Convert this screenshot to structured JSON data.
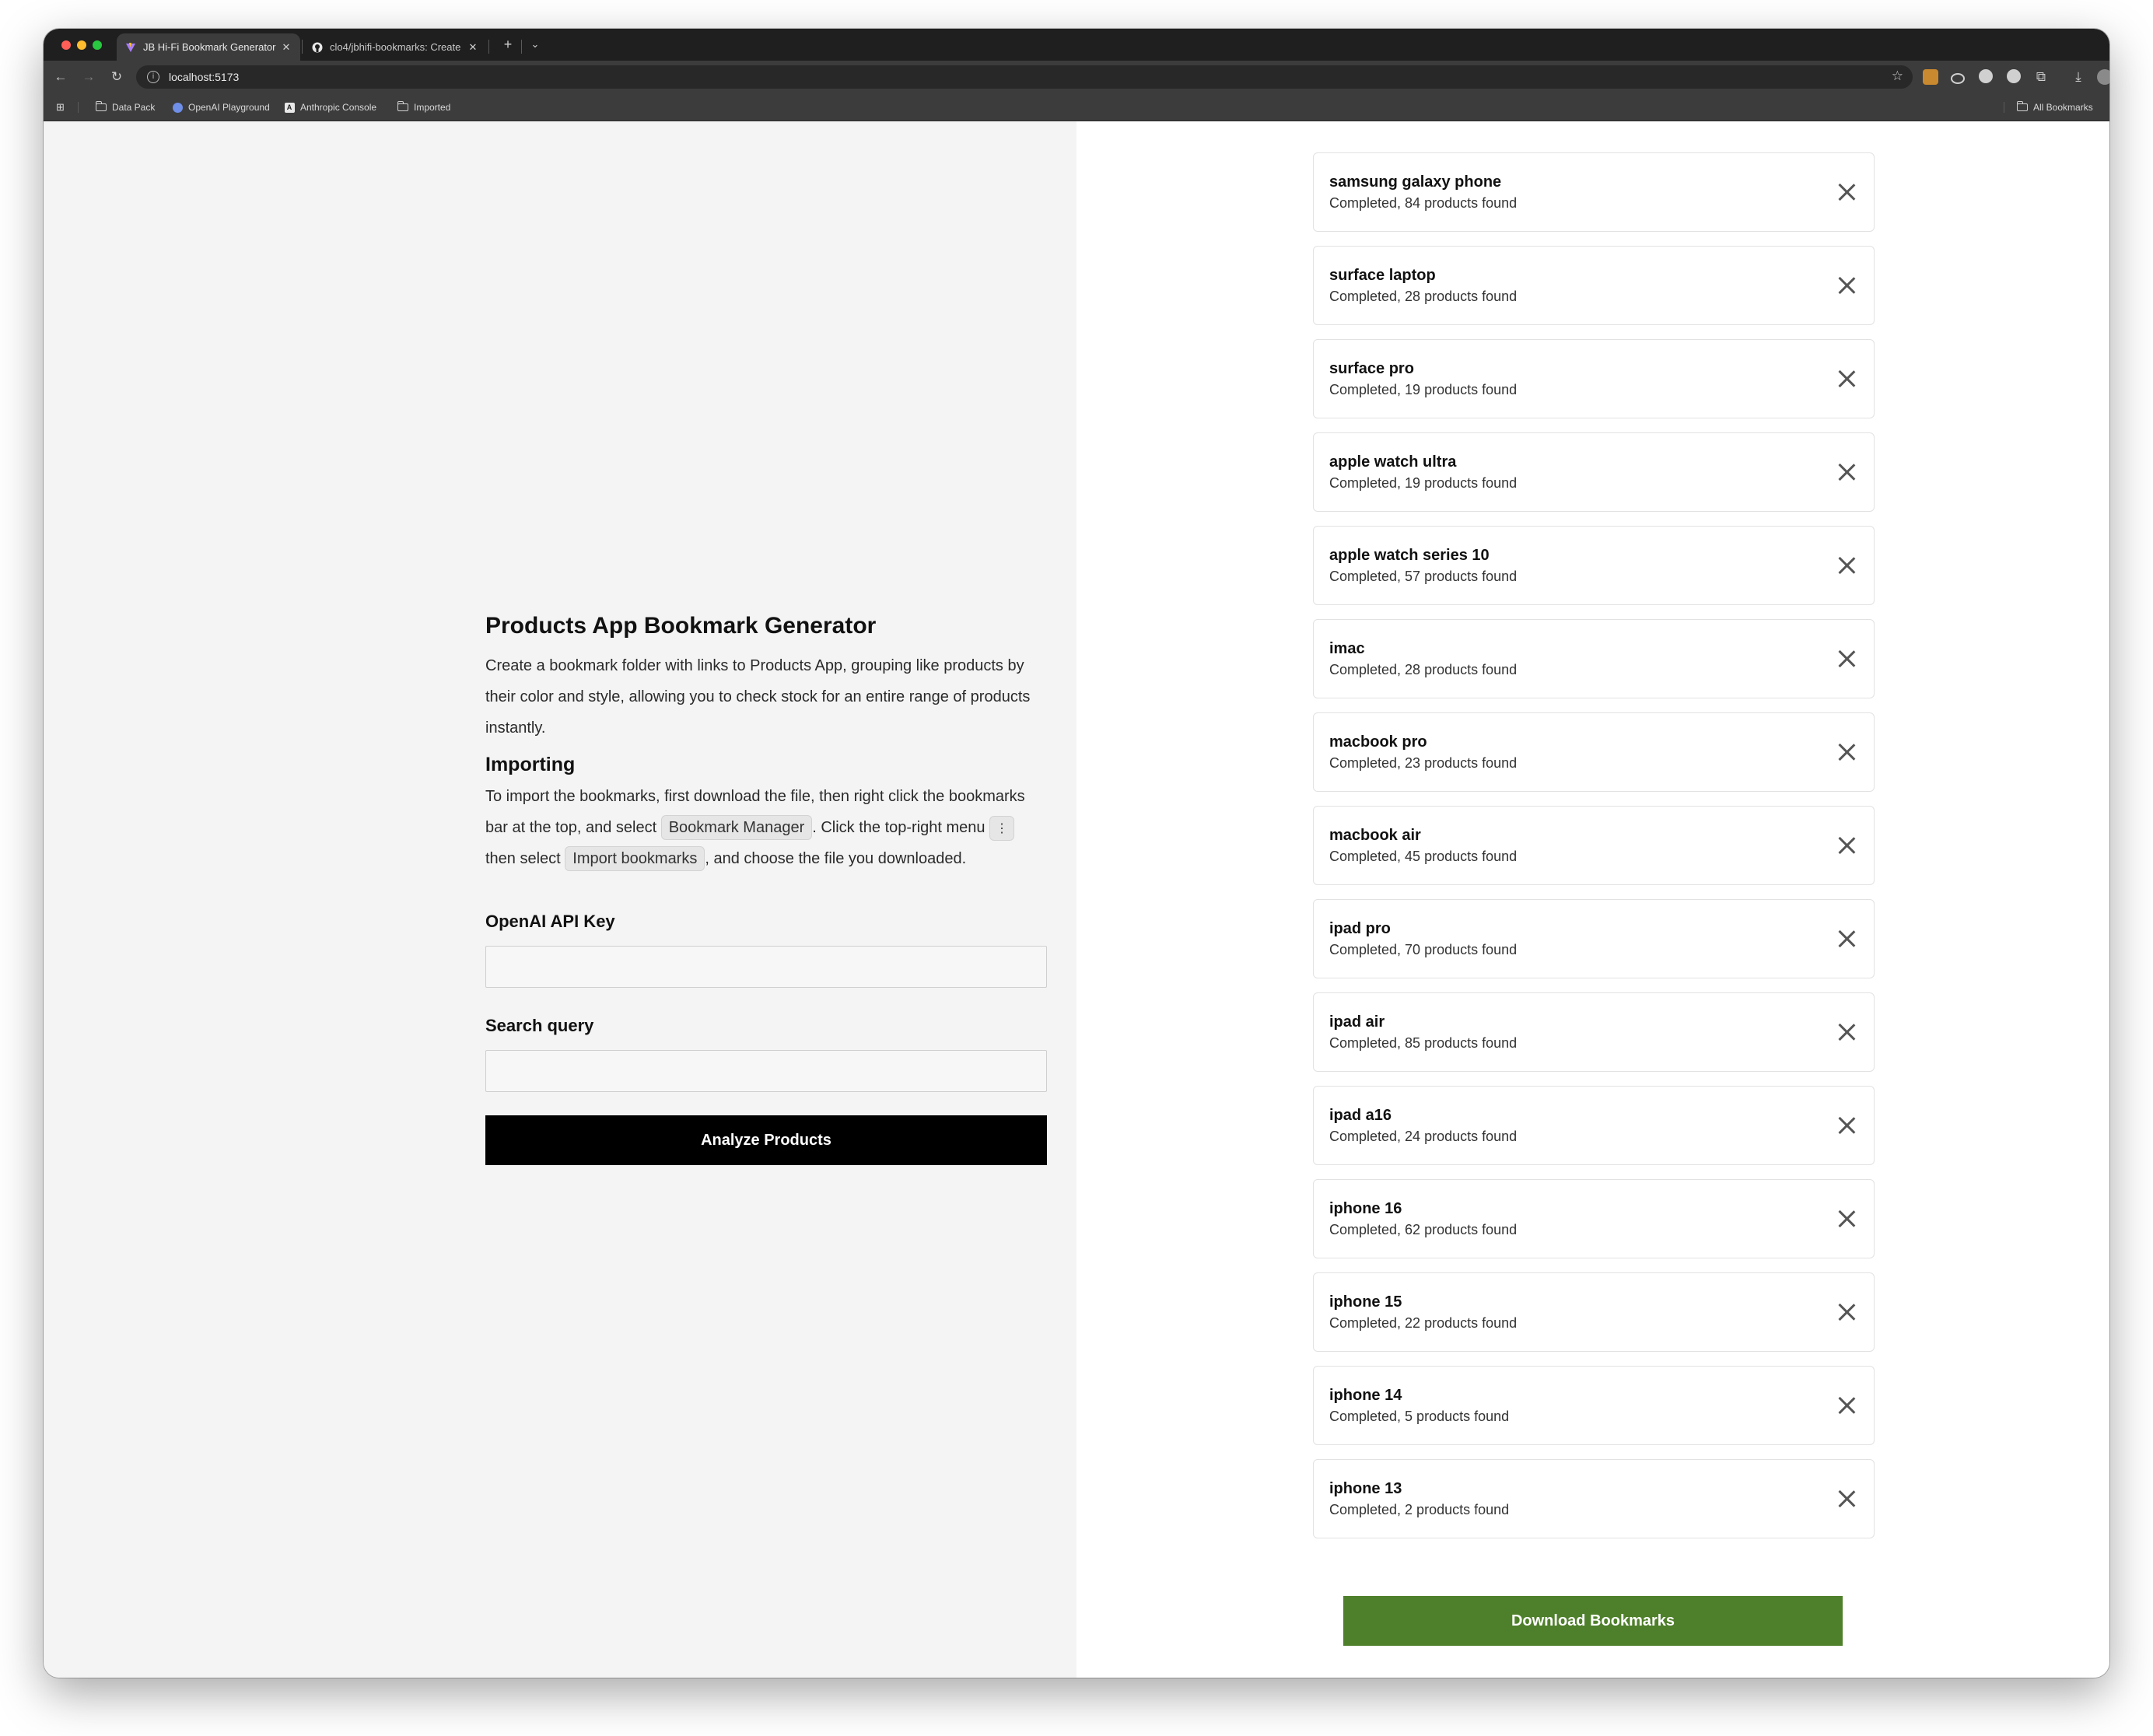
{
  "browser": {
    "tabs": [
      {
        "title": "JB Hi-Fi Bookmark Generator",
        "active": true
      },
      {
        "title": "clo4/jbhifi-bookmarks: Create",
        "active": false
      }
    ],
    "url": "localhost:5173",
    "bookmarks": [
      {
        "label": "Data Pack",
        "icon": "folder-icon"
      },
      {
        "label": "OpenAI Playground",
        "icon": "openai-icon"
      },
      {
        "label": "Anthropic Console",
        "icon": "anthropic-icon"
      },
      {
        "label": "Imported",
        "icon": "folder-icon"
      }
    ],
    "all_bookmarks_label": "All Bookmarks"
  },
  "form": {
    "title": "Products App Bookmark Generator",
    "intro": "Create a bookmark folder with links to Products App, grouping like products by their color and style, allowing you to check stock for an entire range of products instantly.",
    "importing_heading": "Importing",
    "import_text_1": "To import the bookmarks, first download the file, then right click the bookmarks bar at the top, and select ",
    "bookmark_manager": "Bookmark Manager",
    "import_text_2": ". Click the top-right menu ",
    "menu_glyph": "⋮",
    "import_text_3": " then select ",
    "import_bookmarks": "Import bookmarks",
    "import_text_4": ", and choose the file you downloaded.",
    "api_key_label": "OpenAI API Key",
    "api_key_value": "",
    "search_label": "Search query",
    "search_value": "",
    "analyze_button": "Analyze Products"
  },
  "queries": [
    {
      "query": "samsung galaxy phone",
      "status": "Completed, 84 products found"
    },
    {
      "query": "surface laptop",
      "status": "Completed, 28 products found"
    },
    {
      "query": "surface pro",
      "status": "Completed, 19 products found"
    },
    {
      "query": "apple watch ultra",
      "status": "Completed, 19 products found"
    },
    {
      "query": "apple watch series 10",
      "status": "Completed, 57 products found"
    },
    {
      "query": "imac",
      "status": "Completed, 28 products found"
    },
    {
      "query": "macbook pro",
      "status": "Completed, 23 products found"
    },
    {
      "query": "macbook air",
      "status": "Completed, 45 products found"
    },
    {
      "query": "ipad pro",
      "status": "Completed, 70 products found"
    },
    {
      "query": "ipad air",
      "status": "Completed, 85 products found"
    },
    {
      "query": "ipad a16",
      "status": "Completed, 24 products found"
    },
    {
      "query": "iphone 16",
      "status": "Completed, 62 products found"
    },
    {
      "query": "iphone 15",
      "status": "Completed, 22 products found"
    },
    {
      "query": "iphone 14",
      "status": "Completed, 5 products found"
    },
    {
      "query": "iphone 13",
      "status": "Completed, 2 products found"
    }
  ],
  "download_button": "Download Bookmarks",
  "colors": {
    "download_green": "#4e7f2a",
    "analyze_black": "#000000",
    "left_pane_bg": "#f4f4f4"
  }
}
